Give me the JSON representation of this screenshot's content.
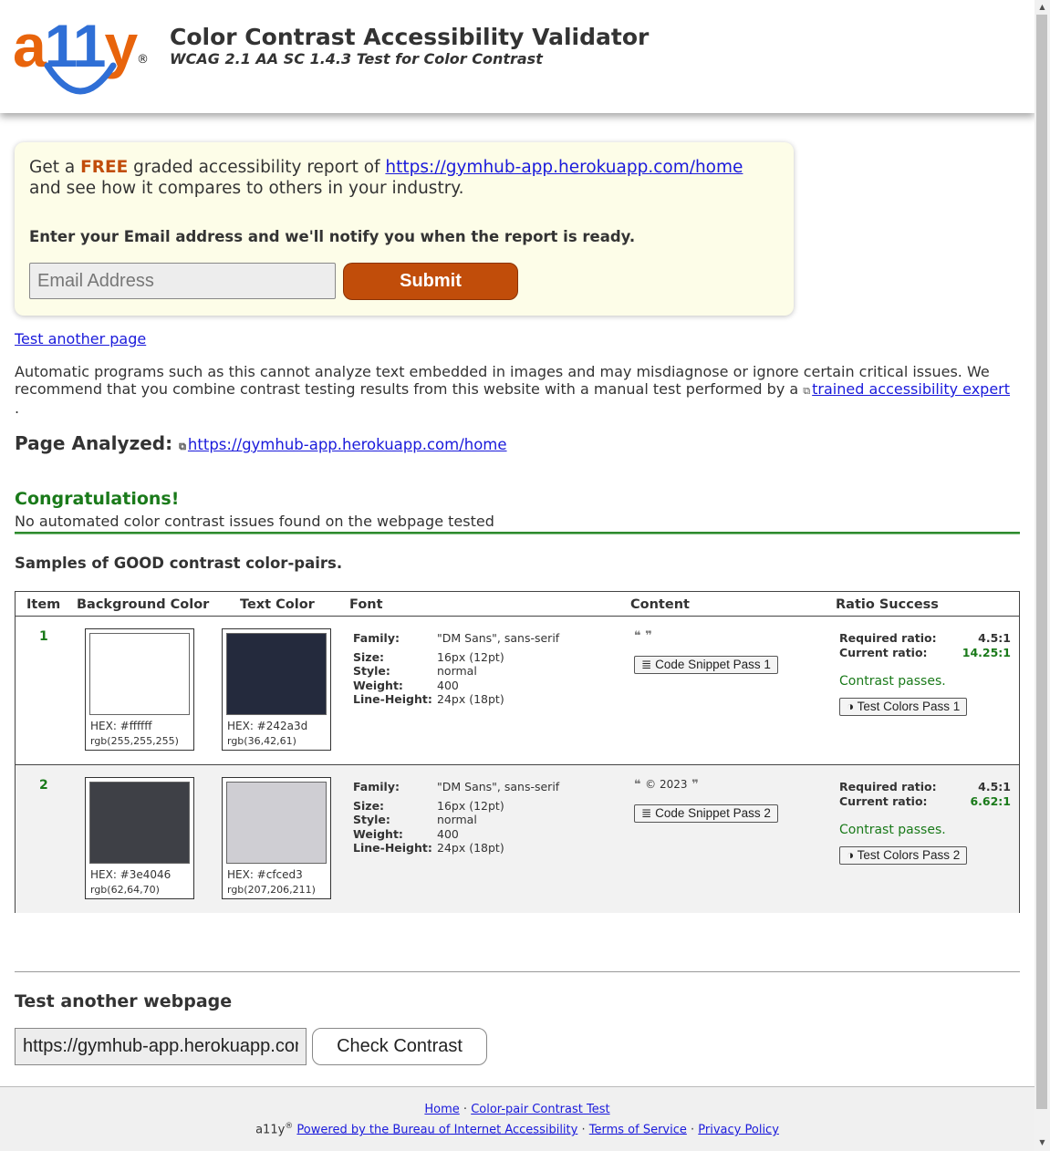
{
  "header": {
    "logo_text": "a11y",
    "logo_reg": "®",
    "title": "Color Contrast Accessibility Validator",
    "subtitle": "WCAG 2.1 AA SC 1.4.3 Test for Color Contrast"
  },
  "promo": {
    "get_a": "Get a",
    "free": "FREE",
    "report_text": "graded accessibility report of",
    "url": "https://gymhub-app.herokuapp.com/home",
    "compare_text": "and see how it compares to others in your industry.",
    "notify_text": "Enter your Email address and we'll notify you when the report is ready.",
    "email_placeholder": "Email Address",
    "submit_label": "Submit"
  },
  "test_another_link": "Test another page",
  "disclaimer": {
    "text": "Automatic programs such as this cannot analyze text embedded in images and may misdiagnose or ignore certain critical issues. We recommend that you combine contrast testing results from this website with a manual test performed by a",
    "link": "trained accessibility expert",
    "end": "."
  },
  "analyzed": {
    "label": "Page Analyzed:",
    "url": "https://gymhub-app.herokuapp.com/home"
  },
  "result": {
    "heading": "Congratulations!",
    "message": "No automated color contrast issues found on the webpage tested"
  },
  "samples_heading": "Samples of GOOD contrast color-pairs.",
  "table": {
    "headers": [
      "Item",
      "Background Color",
      "Text Color",
      "Font",
      "Content",
      "Ratio Success"
    ],
    "font_keys": [
      "Family:",
      "Size:",
      "Style:",
      "Weight:",
      "Line-Height:"
    ],
    "required_label": "Required ratio:",
    "current_label": "Current ratio:",
    "rows": [
      {
        "item": "1",
        "bg": {
          "hex_label": "HEX: #ffffff",
          "rgb_label": "rgb(255,255,255)",
          "color": "#ffffff"
        },
        "text": {
          "hex_label": "HEX: #242a3d",
          "rgb_label": "rgb(36,42,61)",
          "color": "#242a3d"
        },
        "font": {
          "family": "\"DM Sans\", sans-serif",
          "size": "16px (12pt)",
          "style": "normal",
          "weight": "400",
          "line_height": "24px (18pt)"
        },
        "content_quote": "",
        "snippet_label": "Code Snippet Pass 1",
        "required": "4.5:1",
        "current": "14.25:1",
        "status": "Contrast passes.",
        "test_label": "Test Colors Pass 1"
      },
      {
        "item": "2",
        "bg": {
          "hex_label": "HEX: #3e4046",
          "rgb_label": "rgb(62,64,70)",
          "color": "#3e4046"
        },
        "text": {
          "hex_label": "HEX: #cfced3",
          "rgb_label": "rgb(207,206,211)",
          "color": "#cfced3"
        },
        "font": {
          "family": "\"DM Sans\", sans-serif",
          "size": "16px (12pt)",
          "style": "normal",
          "weight": "400",
          "line_height": "24px (18pt)"
        },
        "content_quote": "© 2023",
        "snippet_label": "Code Snippet Pass 2",
        "required": "4.5:1",
        "current": "6.62:1",
        "status": "Contrast passes.",
        "test_label": "Test Colors Pass 2"
      }
    ]
  },
  "test_another": {
    "heading": "Test another webpage",
    "url_value": "https://gymhub-app.herokuapp.com/home",
    "button": "Check Contrast"
  },
  "footer": {
    "home": "Home",
    "sep": "·",
    "pair_test": "Color-pair Contrast Test",
    "brand": "a11y",
    "reg": "®",
    "powered": "Powered by the Bureau of Internet Accessibility",
    "terms": "Terms of Service",
    "privacy": "Privacy Policy"
  },
  "colors": {
    "accent_orange": "#c14d0a",
    "success_green": "#1a7a1a",
    "link_blue": "#1a1adb",
    "promo_bg": "#fdfde8"
  },
  "icons": {
    "external": "external-link-icon",
    "open_quote": "quote-open-icon",
    "close_quote": "quote-close-icon",
    "snippet": "lines-icon",
    "contrast": "half-circle-icon"
  }
}
